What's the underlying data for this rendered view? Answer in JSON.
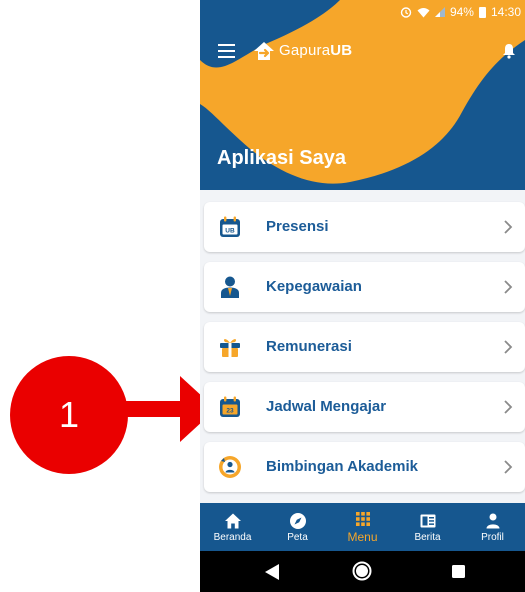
{
  "annotation": {
    "number": "1"
  },
  "status_bar": {
    "battery": "94%",
    "time": "14:30"
  },
  "app": {
    "logo_text_light": "Gapura",
    "logo_text_bold": "UB",
    "title": "Aplikasi Saya"
  },
  "menu_items": [
    {
      "label": "Presensi",
      "icon": "calendar-ub-icon"
    },
    {
      "label": "Kepegawaian",
      "icon": "employee-icon"
    },
    {
      "label": "Remunerasi",
      "icon": "gift-icon"
    },
    {
      "label": "Jadwal Mengajar",
      "icon": "calendar-23-icon"
    },
    {
      "label": "Bimbingan Akademik",
      "icon": "academic-guidance-icon"
    }
  ],
  "icon_text": {
    "calendar_ub": "UB",
    "calendar_23": "23"
  },
  "bottom_nav": [
    {
      "label": "Beranda",
      "icon": "home-icon"
    },
    {
      "label": "Peta",
      "icon": "compass-icon"
    },
    {
      "label": "Menu",
      "icon": "grid-icon",
      "active": true
    },
    {
      "label": "Berita",
      "icon": "news-icon"
    },
    {
      "label": "Profil",
      "icon": "person-icon"
    }
  ],
  "colors": {
    "primary": "#16578f",
    "accent": "#f6a62a",
    "label": "#1c5c98",
    "annotation": "#ea0000"
  }
}
